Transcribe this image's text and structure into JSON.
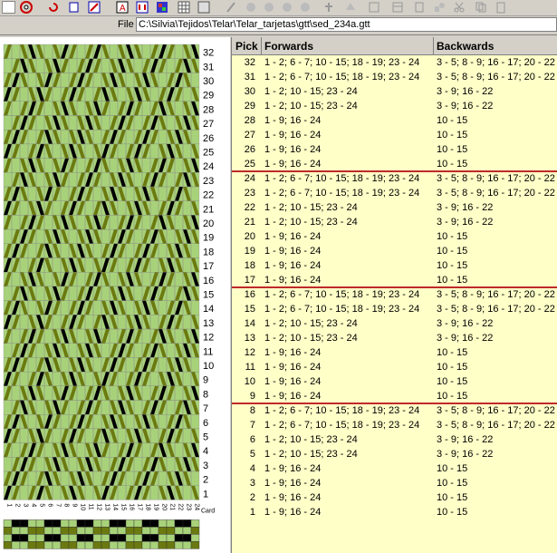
{
  "file": {
    "label": "File",
    "path": "C:\\Silvia\\Tejidos\\Telar\\Telar_tarjetas\\gtt\\sed_234a.gtt"
  },
  "grid": {
    "headers": {
      "pick": "Pick",
      "forwards": "Forwards",
      "backwards": "Backwards"
    },
    "rows": [
      {
        "pick": "32",
        "forwards": "1 - 2; 6 - 7; 10 - 15; 18 - 19; 23 - 24",
        "backwards": "3 - 5; 8 - 9; 16 - 17; 20 - 22"
      },
      {
        "pick": "31",
        "forwards": "1 - 2; 6 - 7; 10 - 15; 18 - 19; 23 - 24",
        "backwards": "3 - 5; 8 - 9; 16 - 17; 20 - 22"
      },
      {
        "pick": "30",
        "forwards": "1 - 2; 10 - 15; 23 - 24",
        "backwards": "3 - 9; 16 - 22"
      },
      {
        "pick": "29",
        "forwards": "1 - 2; 10 - 15; 23 - 24",
        "backwards": "3 - 9; 16 - 22"
      },
      {
        "pick": "28",
        "forwards": "1 - 9; 16 - 24",
        "backwards": "10 - 15"
      },
      {
        "pick": "27",
        "forwards": "1 - 9; 16 - 24",
        "backwards": "10 - 15"
      },
      {
        "pick": "26",
        "forwards": "1 - 9; 16 - 24",
        "backwards": "10 - 15"
      },
      {
        "pick": "25",
        "forwards": "1 - 9; 16 - 24",
        "backwards": "10 - 15"
      },
      {
        "pick": "24",
        "forwards": "1 - 2; 6 - 7; 10 - 15; 18 - 19; 23 - 24",
        "backwards": "3 - 5; 8 - 9; 16 - 17; 20 - 22"
      },
      {
        "pick": "23",
        "forwards": "1 - 2; 6 - 7; 10 - 15; 18 - 19; 23 - 24",
        "backwards": "3 - 5; 8 - 9; 16 - 17; 20 - 22"
      },
      {
        "pick": "22",
        "forwards": "1 - 2; 10 - 15; 23 - 24",
        "backwards": "3 - 9; 16 - 22"
      },
      {
        "pick": "21",
        "forwards": "1 - 2; 10 - 15; 23 - 24",
        "backwards": "3 - 9; 16 - 22"
      },
      {
        "pick": "20",
        "forwards": "1 - 9; 16 - 24",
        "backwards": "10 - 15"
      },
      {
        "pick": "19",
        "forwards": "1 - 9; 16 - 24",
        "backwards": "10 - 15"
      },
      {
        "pick": "18",
        "forwards": "1 - 9; 16 - 24",
        "backwards": "10 - 15"
      },
      {
        "pick": "17",
        "forwards": "1 - 9; 16 - 24",
        "backwards": "10 - 15"
      },
      {
        "pick": "16",
        "forwards": "1 - 2; 6 - 7; 10 - 15; 18 - 19; 23 - 24",
        "backwards": "3 - 5; 8 - 9; 16 - 17; 20 - 22"
      },
      {
        "pick": "15",
        "forwards": "1 - 2; 6 - 7; 10 - 15; 18 - 19; 23 - 24",
        "backwards": "3 - 5; 8 - 9; 16 - 17; 20 - 22"
      },
      {
        "pick": "14",
        "forwards": "1 - 2; 10 - 15; 23 - 24",
        "backwards": "3 - 9; 16 - 22"
      },
      {
        "pick": "13",
        "forwards": "1 - 2; 10 - 15; 23 - 24",
        "backwards": "3 - 9; 16 - 22"
      },
      {
        "pick": "12",
        "forwards": "1 - 9; 16 - 24",
        "backwards": "10 - 15"
      },
      {
        "pick": "11",
        "forwards": "1 - 9; 16 - 24",
        "backwards": "10 - 15"
      },
      {
        "pick": "10",
        "forwards": "1 - 9; 16 - 24",
        "backwards": "10 - 15"
      },
      {
        "pick": "9",
        "forwards": "1 - 9; 16 - 24",
        "backwards": "10 - 15"
      },
      {
        "pick": "8",
        "forwards": "1 - 2; 6 - 7; 10 - 15; 18 - 19; 23 - 24",
        "backwards": "3 - 5; 8 - 9; 16 - 17; 20 - 22"
      },
      {
        "pick": "7",
        "forwards": "1 - 2; 6 - 7; 10 - 15; 18 - 19; 23 - 24",
        "backwards": "3 - 5; 8 - 9; 16 - 17; 20 - 22"
      },
      {
        "pick": "6",
        "forwards": "1 - 2; 10 - 15; 23 - 24",
        "backwards": "3 - 9; 16 - 22"
      },
      {
        "pick": "5",
        "forwards": "1 - 2; 10 - 15; 23 - 24",
        "backwards": "3 - 9; 16 - 22"
      },
      {
        "pick": "4",
        "forwards": "1 - 9; 16 - 24",
        "backwards": "10 - 15"
      },
      {
        "pick": "3",
        "forwards": "1 - 9; 16 - 24",
        "backwards": "10 - 15"
      },
      {
        "pick": "2",
        "forwards": "1 - 9; 16 - 24",
        "backwards": "10 - 15"
      },
      {
        "pick": "1",
        "forwards": "1 - 9; 16 - 24",
        "backwards": "10 - 15"
      }
    ],
    "separators_after_pick": [
      "25",
      "17",
      "9"
    ]
  },
  "draft": {
    "pick_labels": [
      "32",
      "31",
      "30",
      "29",
      "28",
      "27",
      "26",
      "25",
      "24",
      "23",
      "22",
      "21",
      "20",
      "19",
      "18",
      "17",
      "16",
      "15",
      "14",
      "13",
      "12",
      "11",
      "10",
      "9",
      "8",
      "7",
      "6",
      "5",
      "4",
      "3",
      "2",
      "1"
    ],
    "card_label": "Card",
    "card_numbers": [
      "1",
      "2",
      "3",
      "4",
      "5",
      "6",
      "7",
      "8",
      "9",
      "10",
      "11",
      "12",
      "13",
      "14",
      "15",
      "16",
      "17",
      "18",
      "19",
      "20",
      "21",
      "22",
      "23",
      "24"
    ],
    "threading": [
      "S",
      "S",
      "S",
      "S",
      "S",
      "Z",
      "Z",
      "Z",
      "Z",
      "S",
      "S",
      "S",
      "Z",
      "Z",
      "Z",
      "S",
      "S",
      "S",
      "S",
      "Z",
      "Z",
      "Z",
      "Z",
      "Z"
    ],
    "colors": {
      "light": "#a8d27a",
      "olive": "#6b7a10",
      "black": "#000000",
      "line": "#888888"
    }
  }
}
